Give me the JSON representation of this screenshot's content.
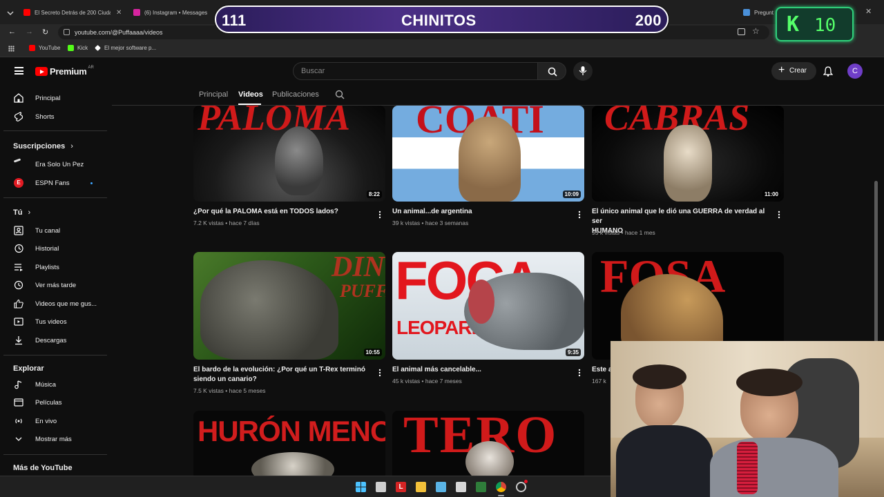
{
  "browser": {
    "tabs": [
      {
        "title": "El Secreto Detrás de 200 Ciudades",
        "color": "#ff0000"
      },
      {
        "title": "(6) Instagram • Messages",
        "color": "#d6249f"
      },
      {
        "title": "Pregunt",
        "color": "#4a90d9"
      }
    ],
    "url": "youtube.com/@Puffaaaa/videos",
    "bookmarks": [
      {
        "label": "YouTube",
        "color": "#ff0000"
      },
      {
        "label": "Kick",
        "color": "#53fc18"
      },
      {
        "label": "El mejor software p...",
        "color": "#ffffff"
      }
    ]
  },
  "overlay": {
    "left_score": "111",
    "center_label": "CHINITOS",
    "right_score": "200",
    "k_letter": "K",
    "k_value": "10"
  },
  "header": {
    "logo": "Premium",
    "region": "AR",
    "search_placeholder": "Buscar",
    "create_label": "Crear",
    "avatar_letter": "C"
  },
  "sidebar": {
    "main": [
      {
        "label": "Principal",
        "icon": "home-icon"
      },
      {
        "label": "Shorts",
        "icon": "shorts-icon"
      }
    ],
    "subs_heading": "Suscripciones",
    "subs": [
      {
        "label": "Era Solo Un Pez"
      },
      {
        "label": "ESPN Fans"
      }
    ],
    "you_heading": "Tú",
    "you": [
      {
        "label": "Tu canal",
        "icon": "channel-icon"
      },
      {
        "label": "Historial",
        "icon": "history-icon"
      },
      {
        "label": "Playlists",
        "icon": "playlists-icon"
      },
      {
        "label": "Ver más tarde",
        "icon": "watch-later-icon"
      },
      {
        "label": "Videos que me gus...",
        "icon": "like-icon"
      },
      {
        "label": "Tus videos",
        "icon": "your-videos-icon"
      },
      {
        "label": "Descargas",
        "icon": "download-icon"
      }
    ],
    "explore_heading": "Explorar",
    "explore": [
      {
        "label": "Música",
        "icon": "music-icon"
      },
      {
        "label": "Películas",
        "icon": "movies-icon"
      },
      {
        "label": "En vivo",
        "icon": "live-icon"
      },
      {
        "label": "Mostrar más",
        "icon": "chevron-down-icon"
      }
    ],
    "more_heading": "Más de YouTube"
  },
  "channel_tabs": [
    "Principal",
    "Videos",
    "Publicaciones"
  ],
  "videos": [
    {
      "thumb_text": "PALOMA",
      "duration": "8:22",
      "title": "¿Por qué la PALOMA está en TODOS lados?",
      "title2": "",
      "meta": "7.2 K vistas • hace 7 días"
    },
    {
      "thumb_text": "COATI",
      "duration": "10:09",
      "title": "Un animal...de argentina",
      "title2": "",
      "meta": "39 k vistas • hace 3 semanas"
    },
    {
      "thumb_text": "CABRAS",
      "duration": "11:00",
      "title": "El único animal que le dió una GUERRA de verdad al ser",
      "title2": "HUMANO",
      "meta": "93 k vistas • hace 1 mes"
    },
    {
      "thumb_text": "DINOS",
      "thumb_text2": "PUFFA",
      "duration": "10:55",
      "title": "El bardo de la evolución: ¿Por qué un T-Rex terminó",
      "title2": "siendo un canario?",
      "meta": "7.5 K vistas • hace 5 meses"
    },
    {
      "thumb_text": "FOCA",
      "thumb_text2": "LEOPARDO",
      "duration": "9:35",
      "title": "El animal más cancelable...",
      "title2": "",
      "meta": "45 k vistas • hace 7 meses"
    },
    {
      "thumb_text": "FOSA",
      "duration": "",
      "title": "Este a",
      "title2": "",
      "meta": "167 k"
    },
    {
      "thumb_text": "HURÓN MENOR",
      "duration": "",
      "title": "",
      "title2": "",
      "meta": ""
    },
    {
      "thumb_text": "TERO",
      "duration": "",
      "title": "",
      "title2": "",
      "meta": ""
    }
  ]
}
